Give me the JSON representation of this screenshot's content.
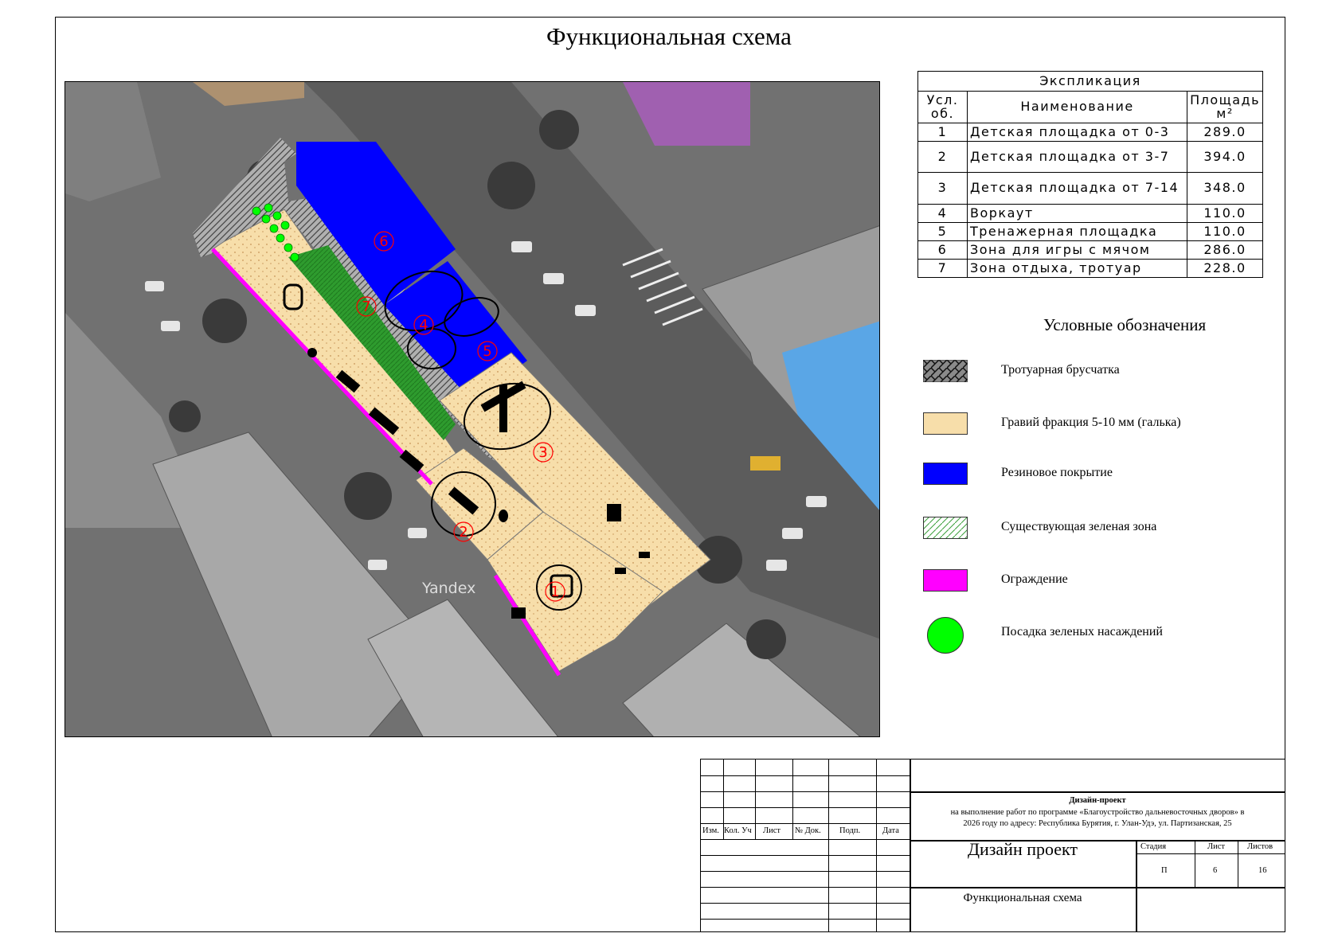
{
  "title": "Функциональная схема",
  "map": {
    "watermark": "Yandex",
    "zone_numbers": [
      "1",
      "2",
      "3",
      "4",
      "5",
      "6",
      "7"
    ],
    "colors": {
      "paving": "#9a9a9a",
      "gravel": "#f7deaa",
      "rubber": "#0000ff",
      "green": "#2e9b2e",
      "fence": "#ff00ff",
      "tree": "#00ff00",
      "marker": "#ff0000"
    }
  },
  "explication": {
    "caption": "Экспликация",
    "headers": {
      "num": "Усл. об.",
      "name": "Наименование",
      "area": "Площадь м²"
    },
    "rows": [
      {
        "num": "1",
        "name": "Детская площадка от 0-3",
        "area": "289.0"
      },
      {
        "num": "2",
        "name": "Детская площадка от 3-7",
        "area": "394.0"
      },
      {
        "num": "3",
        "name": "Детская площадка от 7-14",
        "area": "348.0"
      },
      {
        "num": "4",
        "name": "Воркаут",
        "area": "110.0"
      },
      {
        "num": "5",
        "name": "Тренажерная площадка",
        "area": "110.0"
      },
      {
        "num": "6",
        "name": "Зона для игры с мячом",
        "area": "286.0"
      },
      {
        "num": "7",
        "name": "Зона отдыха, тротуар",
        "area": "228.0"
      }
    ]
  },
  "legend": {
    "title": "Условные обозначения",
    "items": [
      {
        "label": "Тротуарная брусчатка",
        "icon": "paving-pattern"
      },
      {
        "label": "Гравий фракция 5-10 мм (галька)",
        "icon": "gravel-swatch"
      },
      {
        "label": "Резиновое покрытие",
        "icon": "rubber-swatch"
      },
      {
        "label": "Существующая зеленая зона",
        "icon": "hatched-green-swatch"
      },
      {
        "label": "Ограждение",
        "icon": "fence-swatch"
      },
      {
        "label": "Посадка зеленых насаждений",
        "icon": "tree-circle"
      }
    ]
  },
  "stamp": {
    "columns": [
      "Изм.",
      "Кол. Уч",
      "Лист",
      "№ Док.",
      "Подп.",
      "Дата"
    ],
    "project_title": "Дизайн-проект",
    "project_line1": "на выполнение работ по программе «Благоустройство дальневосточных дворов» в",
    "project_line2": "2026 году по адресу: Республика Бурятия, г. Улан-Удэ, ул. Партизанская, 25",
    "name": "Дизайн проект",
    "sheet_name": "Функциональная схема",
    "stage_label": "Стадия",
    "sheet_label": "Лист",
    "sheets_label": "Листов",
    "stage": "П",
    "sheet": "6",
    "sheets": "16"
  }
}
